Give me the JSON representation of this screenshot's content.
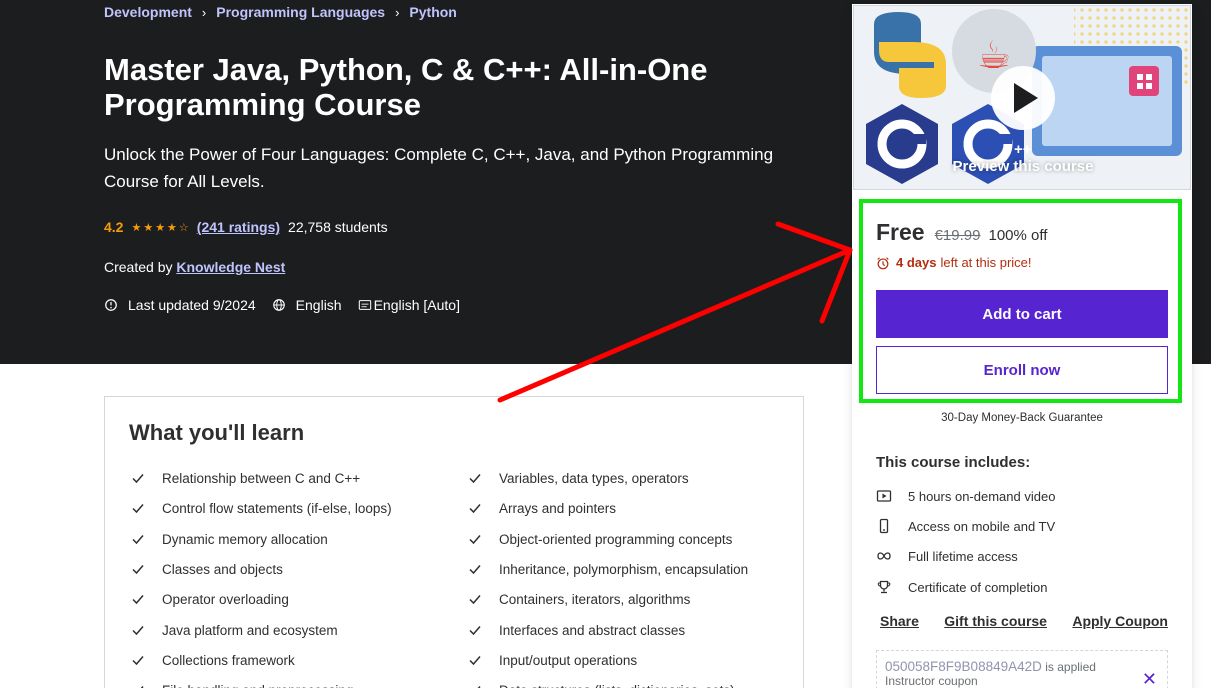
{
  "breadcrumb": [
    "Development",
    "Programming Languages",
    "Python"
  ],
  "course": {
    "title": "Master Java, Python, C & C++: All-in-One Programming Course",
    "subtitle": "Unlock the Power of Four Languages: Complete C, C++, Java, and Python Programming Course for All Levels.",
    "rating": "4.2",
    "ratings_count": "(241 ratings)",
    "students": "22,758 students",
    "created_by_label": "Created by",
    "instructor": "Knowledge Nest",
    "last_updated": "Last updated 9/2024",
    "language": "English",
    "captions": "English [Auto]"
  },
  "learn": {
    "title": "What you'll learn",
    "left": [
      "Relationship between C and C++",
      "Control flow statements (if-else, loops)",
      "Dynamic memory allocation",
      "Classes and objects",
      "Operator overloading",
      "Java platform and ecosystem",
      "Collections framework",
      "File handling and preprocessing"
    ],
    "right": [
      "Variables, data types, operators",
      "Arrays and pointers",
      "Object-oriented programming concepts",
      "Inheritance, polymorphism, encapsulation",
      "Containers, iterators, algorithms",
      "Interfaces and abstract classes",
      "Input/output operations",
      "Data structures (lists, dictionaries, sets)"
    ]
  },
  "sidebar": {
    "preview_label": "Preview this course",
    "price_current": "Free",
    "price_original": "€19.99",
    "discount": "100% off",
    "countdown_days": "4 days",
    "countdown_text": "left at this price!",
    "add_to_cart": "Add to cart",
    "enroll_now": "Enroll now",
    "guarantee": "30-Day Money-Back Guarantee",
    "includes_title": "This course includes:",
    "includes": [
      "5 hours on-demand video",
      "Access on mobile and TV",
      "Full lifetime access",
      "Certificate of completion"
    ],
    "links": [
      "Share",
      "Gift this course",
      "Apply Coupon"
    ],
    "coupon_code": "050058F8F9B08849A42D",
    "coupon_applied": "is applied",
    "coupon_type": "Instructor coupon"
  },
  "colors": {
    "hero_bg": "#1c1d1f",
    "accent_purple": "#5624d0",
    "link_lavender": "#c0c4fc",
    "star_orange": "#f69c08",
    "countdown_red": "#b32d0f",
    "highlight_green": "#14e614",
    "arrow_red": "#ff0000"
  }
}
